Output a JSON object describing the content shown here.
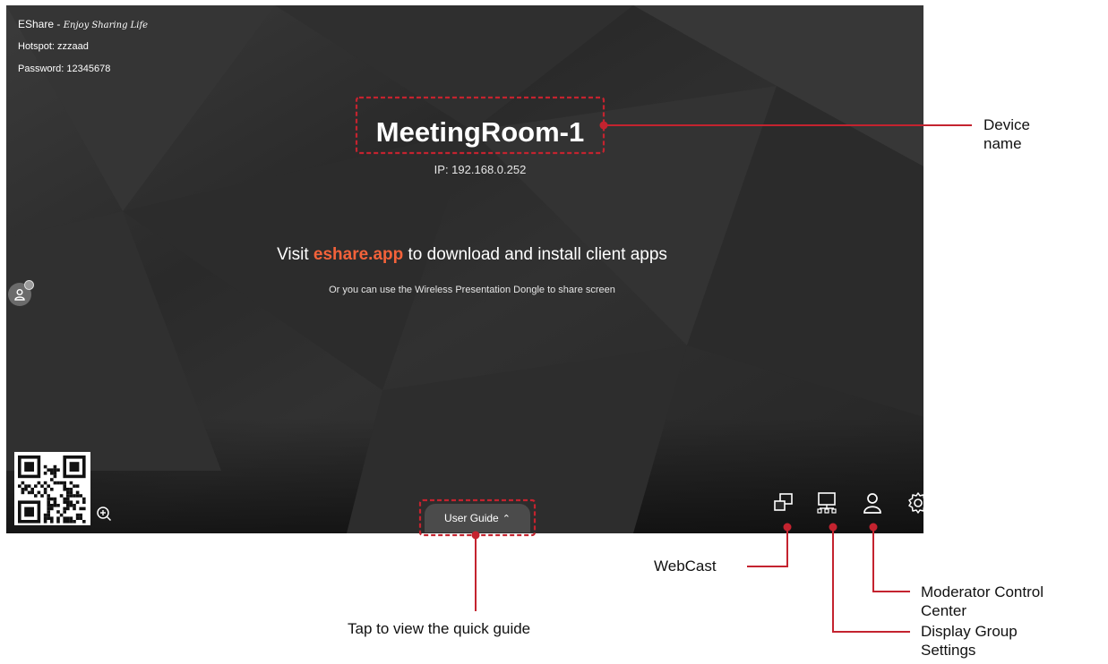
{
  "screen": {
    "brand": "EShare",
    "brand_sep": " - ",
    "tagline": "Enjoy Sharing Life",
    "hotspot": "Hotspot: zzzaad",
    "password": "Password: 12345678",
    "device_name": "MeetingRoom-1",
    "ip": "IP: 192.168.0.252",
    "visit_prefix": "Visit ",
    "visit_link": "eshare.app",
    "visit_suffix": " to download and install client apps",
    "dongle_text": "Or you can use the Wireless Presentation Dongle to share screen",
    "user_guide": "User Guide",
    "toolbar_icons": [
      "webcast-icon",
      "display-group-icon",
      "moderator-icon",
      "settings-icon"
    ]
  },
  "callouts": {
    "device_name": [
      "Device",
      "name"
    ],
    "webcast": "WebCast",
    "moderator": [
      "Moderator Control",
      "Center"
    ],
    "display_group": [
      "Display Group",
      "Settings"
    ],
    "quick_guide": "Tap to view the quick guide"
  },
  "colors": {
    "accent_link": "#f4623a",
    "callout_red": "#c4232f"
  }
}
